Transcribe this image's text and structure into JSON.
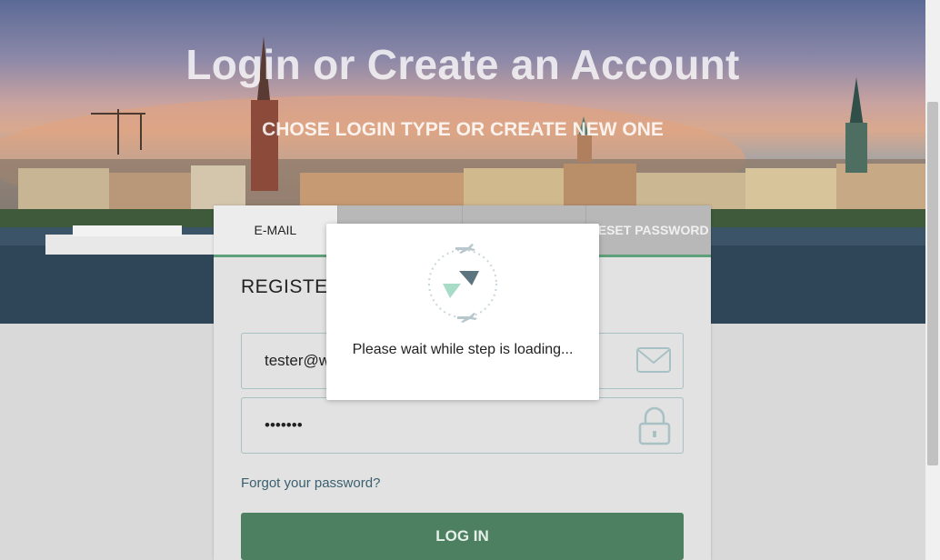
{
  "hero": {
    "title": "Login or Create an Account",
    "subtitle": "CHOSE LOGIN TYPE OR CREATE NEW ONE"
  },
  "tabs": [
    {
      "label": "E-MAIL",
      "active": true
    },
    {
      "label": "",
      "active": false
    },
    {
      "label": "",
      "active": false
    },
    {
      "label": "RESET PASSWORD",
      "active": false
    }
  ],
  "form": {
    "heading": "REGISTER",
    "email_value": "tester@w",
    "password_value": "•••••••",
    "forgot_link": "Forgot your password?",
    "login_button": "LOG IN"
  },
  "modal": {
    "message": "Please wait while step is loading..."
  },
  "colors": {
    "accent_green": "#4c8060",
    "tab_underline": "#5da07a",
    "field_border": "#a7c1c4"
  },
  "icons": {
    "email": "envelope-icon",
    "password": "lock-icon",
    "loader": "plane-loader-icon"
  }
}
